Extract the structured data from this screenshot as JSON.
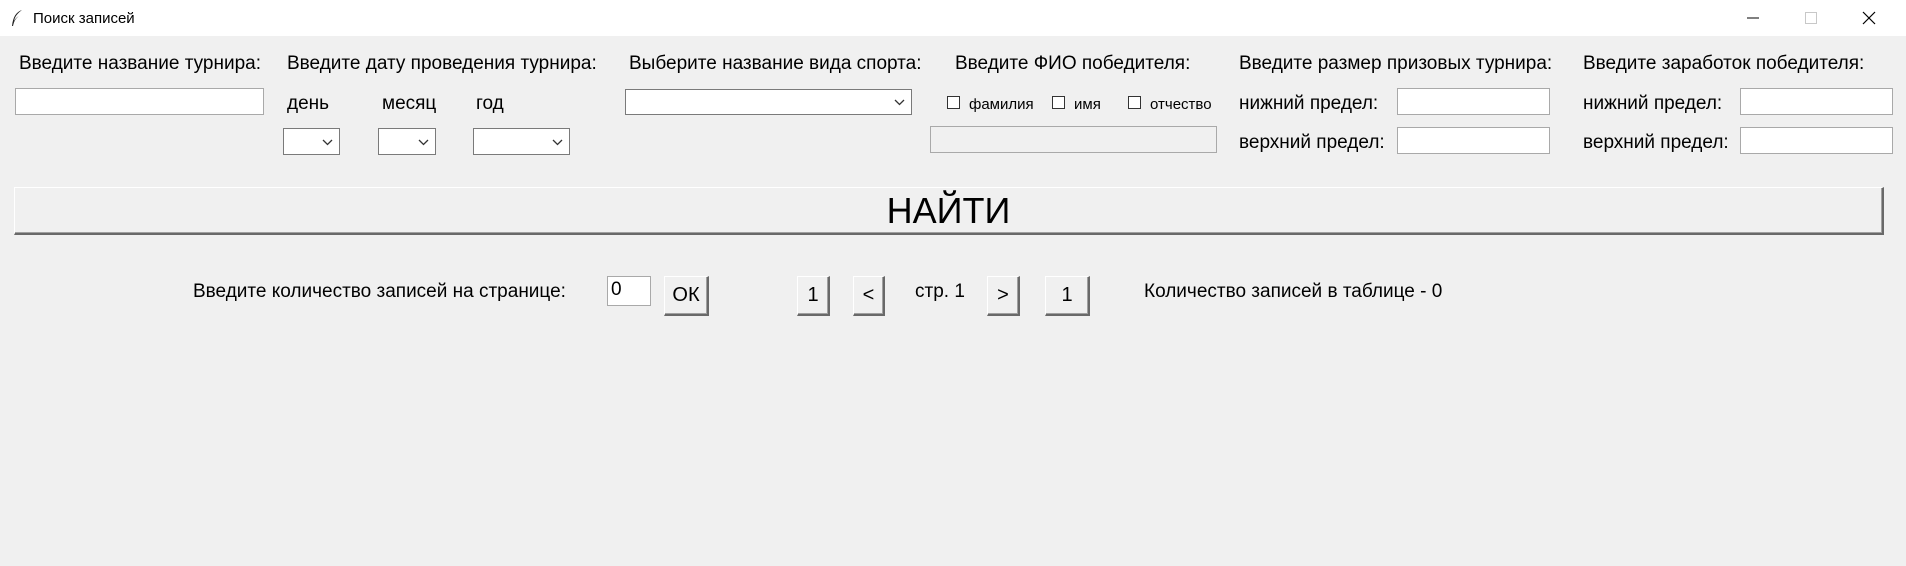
{
  "window": {
    "title": "Поиск записей",
    "icon": "feather-icon",
    "controls": [
      "minimize-icon",
      "maximize-icon",
      "close-icon"
    ]
  },
  "tournament": {
    "label": "Введите название турнира:",
    "value": ""
  },
  "date": {
    "label": "Введите дату проведения турнира:",
    "day_label": "день",
    "month_label": "месяц",
    "year_label": "год",
    "day_value": "",
    "month_value": "",
    "year_value": ""
  },
  "sport": {
    "label": "Выберите название вида спорта:",
    "value": ""
  },
  "winner": {
    "label": "Введите ФИО победителя:",
    "surname_label": "фамилия",
    "name_label": "имя",
    "patronymic_label": "отчество",
    "surname_checked": false,
    "name_checked": false,
    "patronymic_checked": false,
    "value": ""
  },
  "prize": {
    "label": "Введите размер призовых турнира:",
    "lower_label": "нижний предел:",
    "upper_label": "верхний предел:",
    "lower_value": "",
    "upper_value": ""
  },
  "earnings": {
    "label": "Введите заработок победителя:",
    "lower_label": "нижний предел:",
    "upper_label": "верхний предел:",
    "lower_value": "",
    "upper_value": ""
  },
  "find_button": "НАЙТИ",
  "paging": {
    "per_page_label": "Введите количество записей на странице:",
    "per_page_value": "0",
    "ok_button": "ОК",
    "first_button": "1",
    "prev_button": "<",
    "page_text": "стр. 1",
    "next_button": ">",
    "last_button": "1",
    "count_label": "Количество записей в таблице - ",
    "count_value": "0"
  }
}
